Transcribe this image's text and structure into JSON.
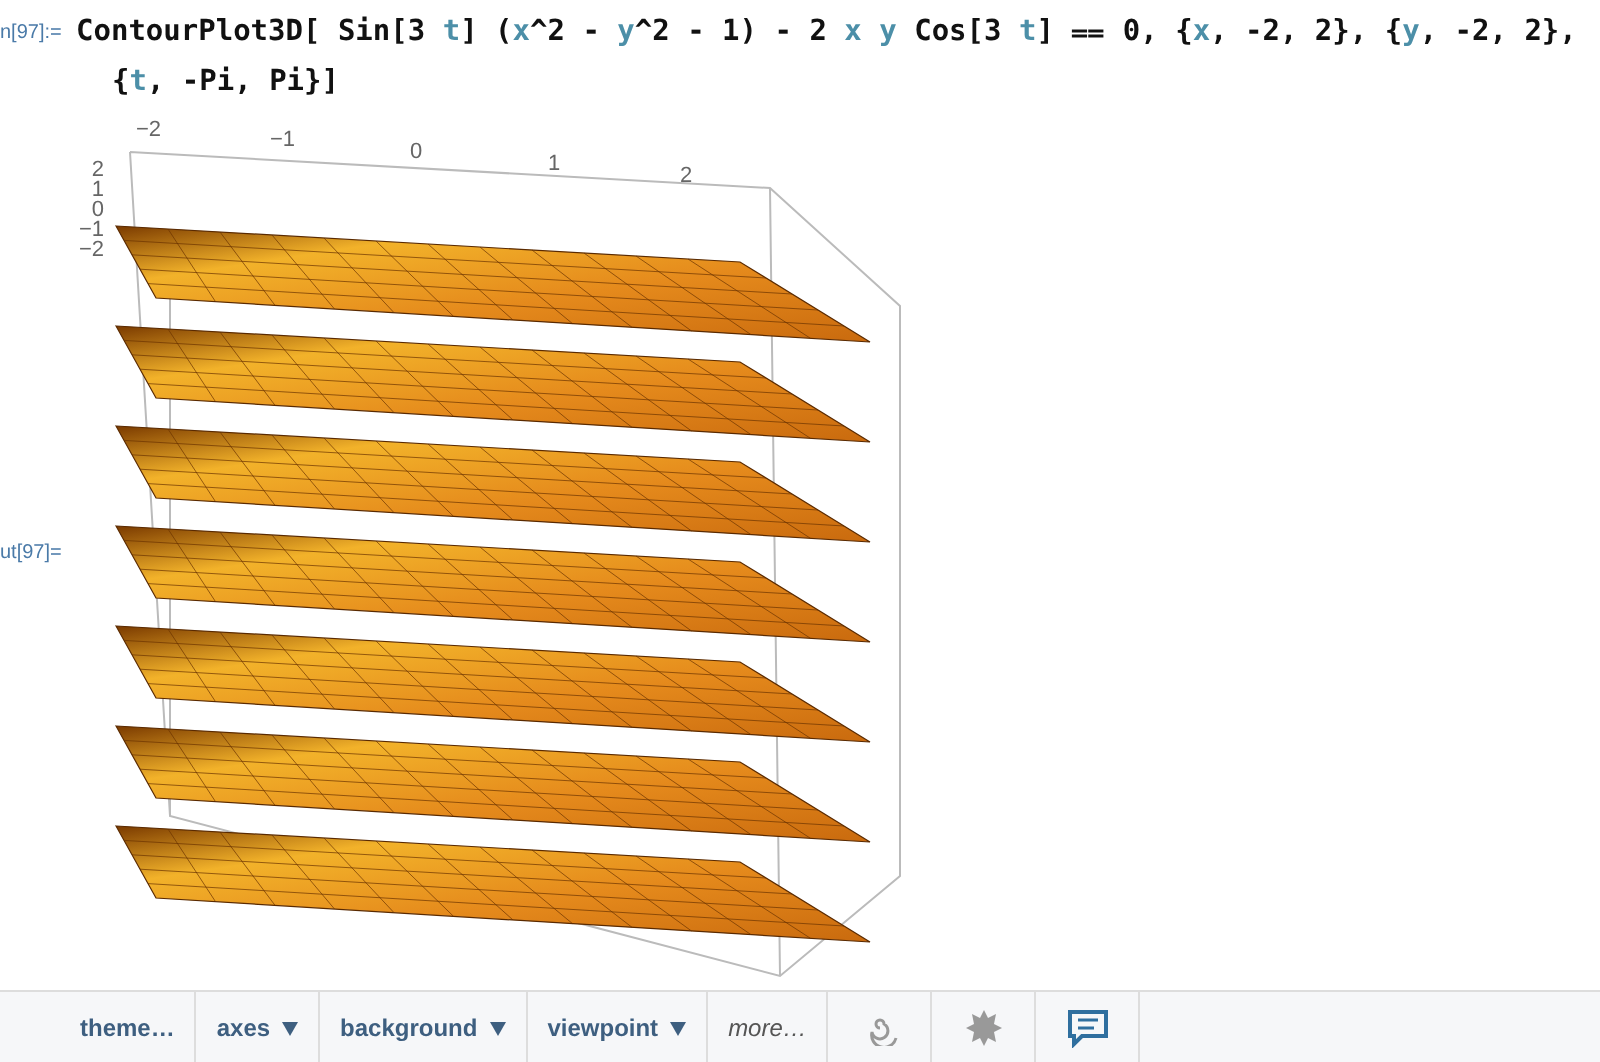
{
  "input": {
    "label": "n[97]:=",
    "lines": [
      [
        {
          "kind": "plain",
          "text": "ContourPlot3D[ Sin[3 "
        },
        {
          "kind": "var",
          "text": "t"
        },
        {
          "kind": "plain",
          "text": "] ("
        },
        {
          "kind": "var",
          "text": "x"
        },
        {
          "kind": "plain",
          "text": "^2 - "
        },
        {
          "kind": "var",
          "text": "y"
        },
        {
          "kind": "plain",
          "text": "^2 - 1) - 2 "
        },
        {
          "kind": "var",
          "text": "x y"
        },
        {
          "kind": "plain",
          "text": " Cos[3 "
        },
        {
          "kind": "var",
          "text": "t"
        },
        {
          "kind": "plain",
          "text": "] ⩵ 0, {"
        },
        {
          "kind": "var",
          "text": "x"
        },
        {
          "kind": "plain",
          "text": ", -2, 2}, {"
        },
        {
          "kind": "var",
          "text": "y"
        },
        {
          "kind": "plain",
          "text": ", -2, 2},"
        }
      ],
      [
        {
          "kind": "plain",
          "text": "{"
        },
        {
          "kind": "var",
          "text": "t"
        },
        {
          "kind": "plain",
          "text": ", -Pi, Pi}]"
        }
      ]
    ]
  },
  "output": {
    "label": "ut[97]=",
    "plot": {
      "top_axis_ticks": [
        "−2",
        "−1",
        "0",
        "1",
        "2"
      ],
      "left_axis_ticks": [
        "2",
        "1",
        "0",
        "−1",
        "−2"
      ]
    }
  },
  "toolbar": {
    "items": [
      {
        "kind": "button",
        "label": "theme…",
        "dropdown": false,
        "italic": false
      },
      {
        "kind": "button",
        "label": "axes",
        "dropdown": true,
        "italic": false
      },
      {
        "kind": "button",
        "label": "background",
        "dropdown": true,
        "italic": false
      },
      {
        "kind": "button",
        "label": "viewpoint",
        "dropdown": true,
        "italic": false
      },
      {
        "kind": "button",
        "label": "more…",
        "dropdown": false,
        "italic": true
      },
      {
        "kind": "spiral"
      },
      {
        "kind": "gear"
      },
      {
        "kind": "chat"
      }
    ]
  }
}
